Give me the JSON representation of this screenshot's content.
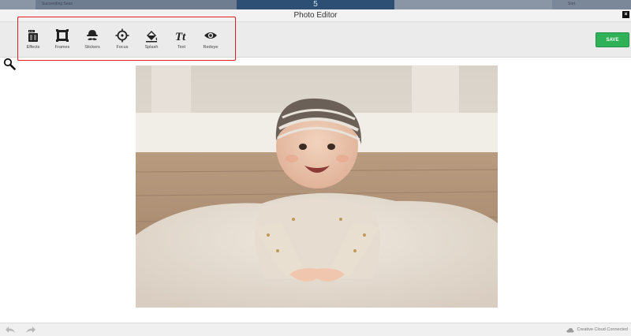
{
  "backdrop": {
    "left_text": "Succeeding Seas",
    "center_number": "5",
    "right_text": "Sort"
  },
  "window": {
    "title": "Photo Editor",
    "close_glyph": "×"
  },
  "toolbar": {
    "tools": [
      {
        "label": "Effects",
        "icon": "effects-icon"
      },
      {
        "label": "Frames",
        "icon": "frames-icon"
      },
      {
        "label": "Stickers",
        "icon": "stickers-icon"
      },
      {
        "label": "Focus",
        "icon": "focus-icon"
      },
      {
        "label": "Splash",
        "icon": "splash-icon"
      },
      {
        "label": "Text",
        "icon": "text-icon"
      },
      {
        "label": "Redeye",
        "icon": "redeye-icon"
      }
    ],
    "save_label": "SAVE"
  },
  "status": {
    "cloud_text": "Creative Cloud Connected"
  },
  "colors": {
    "save": "#2fb157",
    "highlight": "#e02020",
    "toolbar": "#ebebeb"
  }
}
